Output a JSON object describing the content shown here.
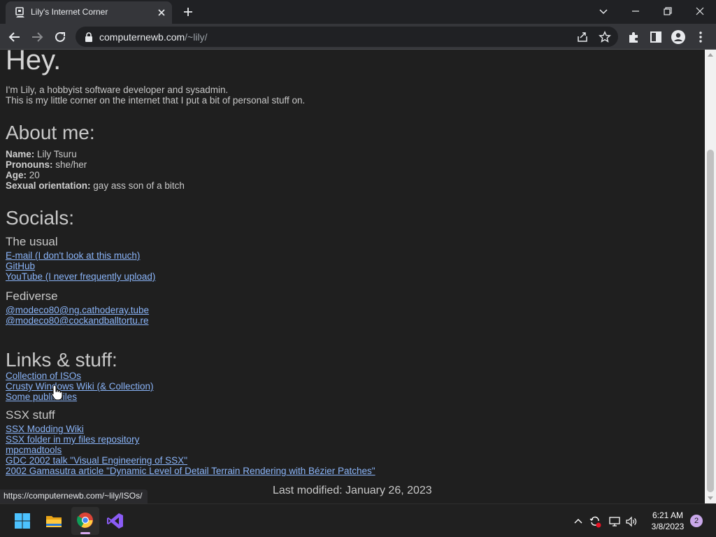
{
  "browser": {
    "tab_title": "Lily's Internet Corner",
    "url_host": "computernewb.com",
    "url_path": "/~lily/",
    "status_url": "https://computernewb.com/~lily/ISOs/"
  },
  "page": {
    "heading": "Hey.",
    "intro_line1": "I'm Lily, a hobbyist software developer and sysadmin.",
    "intro_line2": "This is my little corner on the internet that I put a bit of personal stuff on.",
    "about": {
      "heading": "About me:",
      "fields": [
        {
          "label": "Name:",
          "value": "Lily Tsuru"
        },
        {
          "label": "Pronouns:",
          "value": "she/her"
        },
        {
          "label": "Age:",
          "value": "20"
        },
        {
          "label": "Sexual orientation:",
          "value": "gay ass son of a bitch"
        }
      ]
    },
    "socials": {
      "heading": "Socials:",
      "usual_heading": "The usual",
      "usual_links": [
        "E-mail (I don't look at this much)",
        "GitHub",
        "YouTube (I never frequently upload)"
      ],
      "fediverse_heading": "Fediverse",
      "fediverse_links": [
        "@modeco80@ng.cathoderay.tube",
        "@modeco80@cockandballtortu.re"
      ]
    },
    "links": {
      "heading": "Links & stuff:",
      "items": [
        "Collection of ISOs",
        "Crusty Windows Wiki (& Collection)",
        "Some public files"
      ],
      "ssx_heading": "SSX stuff",
      "ssx_items": [
        "SSX Modding Wiki",
        "SSX folder in my files repository",
        "mpcmadtools",
        "GDC 2002 talk \"Visual Engineering of SSX\"",
        "2002 Gamasutra article \"Dynamic Level of Detail Terrain Rendering with Bézier Patches\""
      ]
    },
    "last_modified": "Last modified: January 26, 2023"
  },
  "taskbar": {
    "time": "6:21 AM",
    "date": "3/8/2023",
    "notification_count": "2"
  }
}
